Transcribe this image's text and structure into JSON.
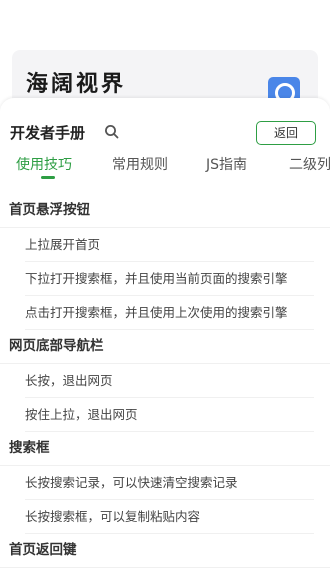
{
  "background_app": {
    "title": "海阔视界",
    "search_icon": "search-icon",
    "accent": "#4a86e8"
  },
  "sheet": {
    "title": "开发者手册",
    "search_icon": "search-icon",
    "back_label": "返回",
    "accent": "#2e9e44"
  },
  "tabs": [
    {
      "label": "使用技巧",
      "active": true
    },
    {
      "label": "常用规则",
      "active": false
    },
    {
      "label": "JS指南",
      "active": false
    },
    {
      "label": "二级列",
      "active": false
    }
  ],
  "sections": [
    {
      "heading": "首页悬浮按钮",
      "items": [
        "上拉展开首页",
        "下拉打开搜索框，并且使用当前页面的搜索引擎",
        "点击打开搜索框，并且使用上次使用的搜索引擎"
      ]
    },
    {
      "heading": "网页底部导航栏",
      "items": [
        "长按，退出网页",
        "按住上拉，退出网页"
      ]
    },
    {
      "heading": "搜索框",
      "items": [
        "长按搜索记录，可以快速清空搜索记录",
        "长按搜索框，可以复制粘贴内容"
      ]
    },
    {
      "heading": "首页返回键",
      "items": []
    }
  ]
}
